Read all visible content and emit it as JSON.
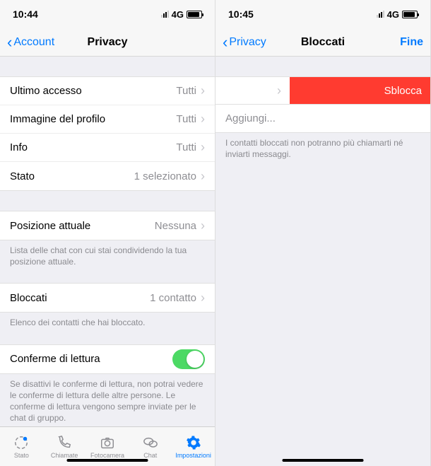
{
  "left": {
    "status": {
      "time": "10:44",
      "net": "4G"
    },
    "nav": {
      "back": "Account",
      "title": "Privacy"
    },
    "rows": {
      "last_seen_label": "Ultimo accesso",
      "last_seen_value": "Tutti",
      "profile_photo_label": "Immagine del profilo",
      "profile_photo_value": "Tutti",
      "info_label": "Info",
      "info_value": "Tutti",
      "status_label": "Stato",
      "status_value": "1 selezionato",
      "position_label": "Posizione attuale",
      "position_value": "Nessuna",
      "position_footer": "Lista delle chat con cui stai condividendo la tua posizione attuale.",
      "blocked_label": "Bloccati",
      "blocked_value": "1 contatto",
      "blocked_footer": "Elenco dei contatti che hai bloccato.",
      "read_receipts_label": "Conferme di lettura",
      "read_receipts_footer": "Se disattivi le conferme di lettura, non potrai vedere le conferme di lettura delle altre persone. Le conferme di lettura vengono sempre inviate per le chat di gruppo."
    },
    "tabs": {
      "stato": "Stato",
      "chiamate": "Chiamate",
      "fotocamera": "Fotocamera",
      "chat": "Chat",
      "impostazioni": "Impostazioni"
    }
  },
  "right": {
    "status": {
      "time": "10:45",
      "net": "4G"
    },
    "nav": {
      "back": "Privacy",
      "title": "Bloccati",
      "done": "Fine"
    },
    "unblock_label": "Sblocca",
    "add_label": "Aggiungi...",
    "footer": "I contatti bloccati non potranno più chiamarti né inviarti messaggi."
  }
}
